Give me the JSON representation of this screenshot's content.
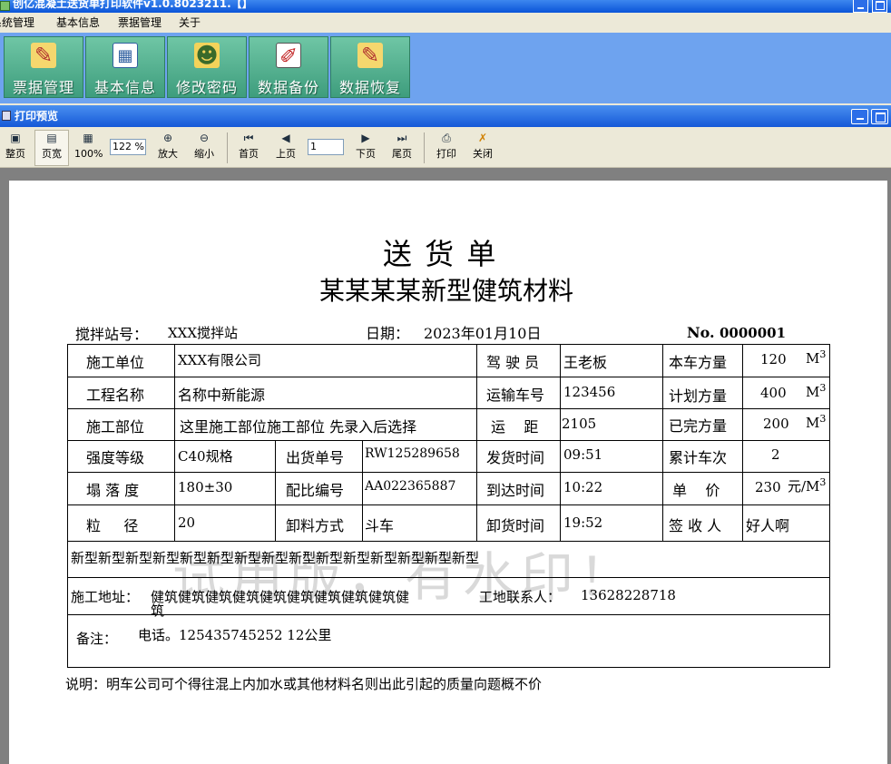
{
  "window": {
    "title": "创亿混凝土送货单打印软件v1.0.8023211.【】"
  },
  "menu": [
    "系统管理",
    "基本信息",
    "票据管理",
    "关于"
  ],
  "main_toolbar": [
    {
      "label": "票据管理",
      "icon": "notepad-pencil-icon"
    },
    {
      "label": "基本信息",
      "icon": "calendar-grid-icon"
    },
    {
      "label": "修改密码",
      "icon": "users-icon"
    },
    {
      "label": "数据备份",
      "icon": "pencil-book-icon"
    },
    {
      "label": "数据恢复",
      "icon": "notepad-restore-icon"
    }
  ],
  "preview": {
    "title": "打印预览",
    "buttons": {
      "whole": "整页",
      "width": "页宽",
      "hundred": "100%",
      "zoom_in": "放大",
      "zoom_out": "缩小",
      "first": "首页",
      "prev": "上页",
      "next": "下页",
      "last": "尾页",
      "print": "打印",
      "close": "关闭"
    },
    "zoom_value": "122 %",
    "page_value": "1"
  },
  "doc": {
    "title": "送 货 单",
    "company": "某某某某新型健筑材料",
    "station_label": "搅拌站号：",
    "station_value": "XXX搅拌站",
    "date_label": "日期：",
    "date_value": "2023年01月10日",
    "no_label": "No.",
    "no_value": "0000001",
    "rows": {
      "construction_unit": {
        "label": "施工单位",
        "value": "XXX有限公司"
      },
      "driver": {
        "label": "驾 驶 员",
        "value": "王老板"
      },
      "this_volume": {
        "label": "本车方量",
        "value": "120"
      },
      "project_name": {
        "label": "工程名称",
        "value": "名称中新能源"
      },
      "truck_no": {
        "label": "运输车号",
        "value": "123456"
      },
      "planned_volume": {
        "label": "计划方量",
        "value": "400"
      },
      "construction_part": {
        "label": "施工部位",
        "value": "这里施工部位施工部位 先录入后选择"
      },
      "distance": {
        "label": "运    距",
        "value": "2105"
      },
      "completed_volume": {
        "label": "已完方量",
        "value": "200"
      },
      "strength": {
        "label": "强度等级",
        "value": "C40规格"
      },
      "shipment_no": {
        "label": "出货单号",
        "value": "RW125289658"
      },
      "ship_time": {
        "label": "发货时间",
        "value": "09:51"
      },
      "trips": {
        "label": "累计车次",
        "value": "2"
      },
      "slump": {
        "label": "塌 落 度",
        "value": "180±30"
      },
      "mix_no": {
        "label": "配比编号",
        "value": "AA022365887"
      },
      "arrive_time": {
        "label": "到达时间",
        "value": "10:22"
      },
      "unit_price": {
        "label": "单    价",
        "value": "230"
      },
      "particle": {
        "label": "粒     径",
        "value": "20"
      },
      "unload_method": {
        "label": "卸料方式",
        "value": "斗车"
      },
      "unload_time": {
        "label": "卸货时间",
        "value": "19:52"
      },
      "receiver": {
        "label": "签 收 人",
        "value": "好人啊"
      }
    },
    "unit_m": "M",
    "unit_exp": "3",
    "price_unit": "元/M",
    "remark_line": "新型新型新型新型新型新型新型新型新型新型新型新型新型新型新型",
    "address_label": "施工地址：",
    "address_value_line1": "健筑健筑健筑健筑健筑健筑健筑健筑健筑健",
    "address_value_line2": "筑",
    "contact_label": "工地联系人：",
    "contact_value": "13628228718",
    "note_label": "备注：",
    "note_value": "电话。125435745252 12公里",
    "footer": "说明：明车公司可个得往混上内加水或其他材料名则出此引起的质量向题概不价",
    "watermark": "试用版，有水印！"
  }
}
